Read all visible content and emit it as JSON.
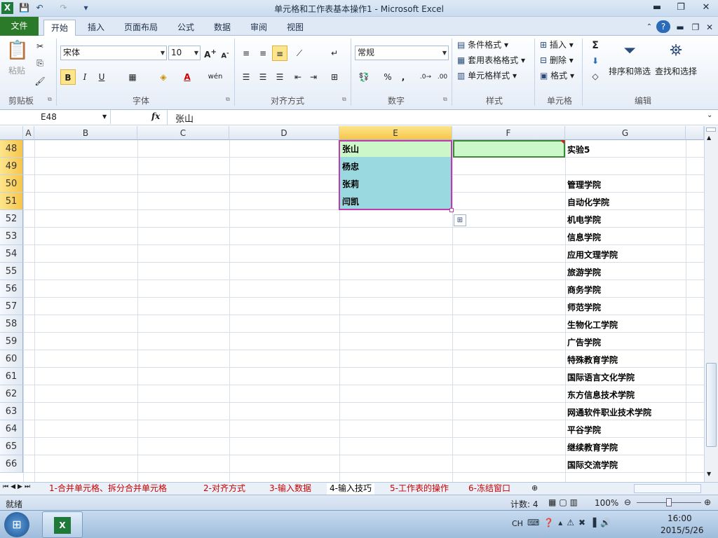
{
  "window": {
    "title": "单元格和工作表基本操作1  -  Microsoft Excel",
    "minimize": "▬",
    "maximize": "❐",
    "close": "✕"
  },
  "qat": {
    "save": "💾",
    "undo": "↶",
    "redo": "↷",
    "customize": "▾"
  },
  "tabs": [
    {
      "label": "文件"
    },
    {
      "label": "开始"
    },
    {
      "label": "插入"
    },
    {
      "label": "页面布局"
    },
    {
      "label": "公式"
    },
    {
      "label": "数据"
    },
    {
      "label": "审阅"
    },
    {
      "label": "视图"
    }
  ],
  "ribbon": {
    "clipboard": {
      "group": "剪贴板",
      "paste": "粘贴"
    },
    "font": {
      "group": "字体",
      "name": "宋体",
      "size": "10",
      "bold": "B",
      "italic": "I",
      "underline": "U"
    },
    "alignment": {
      "group": "对齐方式"
    },
    "number": {
      "group": "数字",
      "format": "常规",
      "percent": "%",
      "comma": ","
    },
    "styles": {
      "group": "样式",
      "conditional": "条件格式",
      "table": "套用表格格式",
      "cell": "单元格样式"
    },
    "cells": {
      "group": "单元格",
      "insert": "插入",
      "delete": "删除",
      "format": "格式"
    },
    "editing": {
      "group": "编辑",
      "sum": "Σ",
      "sort": "排序和筛选",
      "find": "查找和选择"
    }
  },
  "formula_bar": {
    "name_box": "E48",
    "fx": "fx",
    "content": "张山"
  },
  "columns": [
    "A",
    "B",
    "C",
    "D",
    "E",
    "F",
    "G"
  ],
  "rows": [
    "48",
    "49",
    "50",
    "51",
    "52",
    "53",
    "54",
    "55",
    "56",
    "57",
    "58",
    "59",
    "60",
    "61",
    "62",
    "63",
    "64",
    "65",
    "66"
  ],
  "cells": {
    "E": [
      "张山",
      "杨忠",
      "张莉",
      "闫凯"
    ],
    "G": [
      "实验5",
      "",
      "管理学院",
      "自动化学院",
      "机电学院",
      "信息学院",
      "应用文理学院",
      "旅游学院",
      "商务学院",
      "师范学院",
      "生物化工学院",
      "广告学院",
      "特殊教育学院",
      "国际语言文化学院",
      "东方信息技术学院",
      "网通软件职业技术学院",
      "平谷学院",
      "继续教育学院",
      "国际交流学院"
    ]
  },
  "sheet_tabs": [
    {
      "label": "1-合并单元格、拆分合并单元格"
    },
    {
      "label": "2-对齐方式"
    },
    {
      "label": "3-输入数据"
    },
    {
      "label": "4-输入技巧"
    },
    {
      "label": "5-工作表的操作"
    },
    {
      "label": "6-冻结窗口"
    }
  ],
  "status": {
    "ready": "就绪",
    "count": "计数: 4",
    "zoom": "100%"
  },
  "taskbar": {
    "lang": "CH",
    "time": "16:00",
    "date": "2015/5/26"
  },
  "colors": {
    "selection_fill": "#9ad9e0",
    "active_fill": "#ccf7c8",
    "selection_border": "#c03bb0",
    "file_tab": "#2a7a2a",
    "sheet_tab_text": "#cc0000"
  }
}
